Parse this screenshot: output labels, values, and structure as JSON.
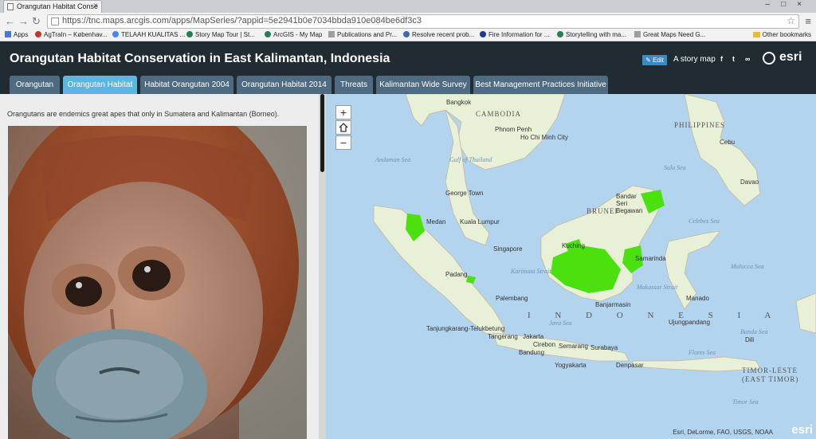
{
  "browser": {
    "tab_title": "Orangutan Habitat Conse",
    "url": "https://tnc.maps.arcgis.com/apps/MapSeries/?appid=5e2941b0e7034bbda910e084be6df3c3",
    "bookmarks": [
      {
        "label": "Apps",
        "color": "#4a7bd0"
      },
      {
        "label": "AgTraIn – Københav...",
        "color": "#c0392b"
      },
      {
        "label": "TELAAH KUALITAS ...",
        "color": "#4285f4"
      },
      {
        "label": "Story Map Tour | St...",
        "color": "#2a7e4f"
      },
      {
        "label": "ArcGIS - My Map",
        "color": "#2a7e4f"
      },
      {
        "label": "Publications and Pr...",
        "color": "#9e9e9e"
      },
      {
        "label": "Resolve recent prob...",
        "color": "#3a6ea5"
      },
      {
        "label": "Fire Information for ...",
        "color": "#1a3c8f"
      },
      {
        "label": "Storytelling with ma...",
        "color": "#2a7e4f"
      },
      {
        "label": "Great Maps Need G...",
        "color": "#9e9e9e"
      }
    ],
    "other_bookmarks": "Other bookmarks"
  },
  "header": {
    "title": "Orangutan Habitat Conservation in East Kalimantan, Indonesia",
    "edit_label": "Edit",
    "story_map_label": "A story map",
    "logo_text": "esri"
  },
  "tabs": [
    {
      "label": "Orangutan",
      "active": false
    },
    {
      "label": "Orangutan Habitat",
      "active": true
    },
    {
      "label": "Habitat Orangutan 2004",
      "active": false
    },
    {
      "label": "Orangutan Habitat 2014",
      "active": false
    },
    {
      "label": "Threats",
      "active": false
    },
    {
      "label": "Kalimantan Wide Survey",
      "active": false
    },
    {
      "label": "Best Management Practices Initiative",
      "active": false
    }
  ],
  "panel": {
    "intro": "Orangutans are endemics great apes that only in Sumatera and Kalimantan (Borneo)."
  },
  "map": {
    "zoom_in": "+",
    "zoom_out": "−",
    "attribution": "Esri, DeLorme, FAO, USGS, NOAA",
    "logo": "esri",
    "countries": [
      "CAMBODIA",
      "PHILIPPINES",
      "BRUNEI",
      "I N D O N E S I A",
      "TIMOR-LESTE",
      "(EAST TIMOR)"
    ],
    "seas": [
      "Andaman Sea",
      "Gulf of Thailand",
      "Celebes Sea",
      "Java Sea",
      "Karimata Strait",
      "Makassar Strait",
      "Sulu Sea",
      "Molucca Sea",
      "Banda Sea",
      "Timor Sea",
      "Flores Sea"
    ],
    "cities": [
      "Bangkok",
      "Phnom Penh",
      "Ho Chi Minh City",
      "George Town",
      "Medan",
      "Kuala Lumpur",
      "Singapore",
      "Padang",
      "Palembang",
      "Tanjungkarang-Telukbetung",
      "Tangerang",
      "Jakarta",
      "Cirebon",
      "Bandung",
      "Semarang",
      "Surabaya",
      "Yogyakarta",
      "Denpasar",
      "Kuching",
      "Bandar Seri Begawan",
      "Samarinda",
      "Banjarmasin",
      "Manado",
      "Ujungpandang",
      "Cebu",
      "Davao",
      "Dili"
    ],
    "habitat_color": "#4be10f"
  }
}
